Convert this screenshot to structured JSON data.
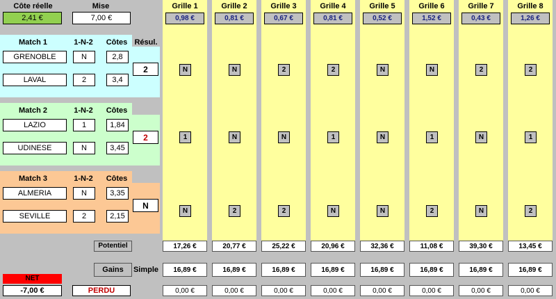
{
  "header": {
    "cote_reelle_label": "Côte réelle",
    "cote_reelle_value": "2,41 €",
    "mise_label": "Mise",
    "mise_value": "7,00 €",
    "resul_label": "Résul."
  },
  "matches": [
    {
      "title": "Match 1",
      "col_1n2": "1-N-2",
      "col_cotes": "Côtes",
      "team1": "GRENOBLE",
      "pick1": "N",
      "cote1": "2,8",
      "team2": "LAVAL",
      "pick2": "2",
      "cote2": "3,4",
      "result": "2"
    },
    {
      "title": "Match 2",
      "col_1n2": "1-N-2",
      "col_cotes": "Côtes",
      "team1": "LAZIO",
      "pick1": "1",
      "cote1": "1,84",
      "team2": "UDINESE",
      "pick2": "N",
      "cote2": "3,45",
      "result": "2"
    },
    {
      "title": "Match 3",
      "col_1n2": "1-N-2",
      "col_cotes": "Côtes",
      "team1": "ALMERIA",
      "pick1": "N",
      "cote1": "3,35",
      "team2": "SEVILLE",
      "pick2": "2",
      "cote2": "2,15",
      "result": "N"
    }
  ],
  "grilles": [
    {
      "name": "Grille 1",
      "cote": "0,98 €",
      "picks": [
        "N",
        "1",
        "N"
      ],
      "potentiel": "17,26 €",
      "gains": "16,89 €",
      "net": "0,00 €"
    },
    {
      "name": "Grille 2",
      "cote": "0,81 €",
      "picks": [
        "N",
        "N",
        "2"
      ],
      "potentiel": "20,77 €",
      "gains": "16,89 €",
      "net": "0,00 €"
    },
    {
      "name": "Grille 3",
      "cote": "0,67 €",
      "picks": [
        "2",
        "N",
        "2"
      ],
      "potentiel": "25,22 €",
      "gains": "16,89 €",
      "net": "0,00 €"
    },
    {
      "name": "Grille 4",
      "cote": "0,81 €",
      "picks": [
        "2",
        "1",
        "N"
      ],
      "potentiel": "20,96 €",
      "gains": "16,89 €",
      "net": "0,00 €"
    },
    {
      "name": "Grille 5",
      "cote": "0,52 €",
      "picks": [
        "N",
        "N",
        "N"
      ],
      "potentiel": "32,36 €",
      "gains": "16,89 €",
      "net": "0,00 €"
    },
    {
      "name": "Grille 6",
      "cote": "1,52 €",
      "picks": [
        "N",
        "1",
        "2"
      ],
      "potentiel": "11,08 €",
      "gains": "16,89 €",
      "net": "0,00 €"
    },
    {
      "name": "Grille 7",
      "cote": "0,43 €",
      "picks": [
        "2",
        "N",
        "N"
      ],
      "potentiel": "39,30 €",
      "gains": "16,89 €",
      "net": "0,00 €"
    },
    {
      "name": "Grille 8",
      "cote": "1,26 €",
      "picks": [
        "2",
        "1",
        "2"
      ],
      "potentiel": "13,45 €",
      "gains": "16,89 €",
      "net": "0,00 €"
    }
  ],
  "footer": {
    "potentiel_label": "Potentiel",
    "gains_label": "Gains",
    "simple_label": "Simple",
    "net_label": "NET",
    "net_value": "-7,00 €",
    "status": "PERDU"
  },
  "colors": {
    "match1_bg": "#ccffff",
    "match2_bg": "#ccffcc",
    "match3_bg": "#fcc895",
    "grille_bg": "#ffff9e",
    "green_box": "#92d050",
    "net_red": "#ff0000",
    "status_red": "#c00000"
  }
}
